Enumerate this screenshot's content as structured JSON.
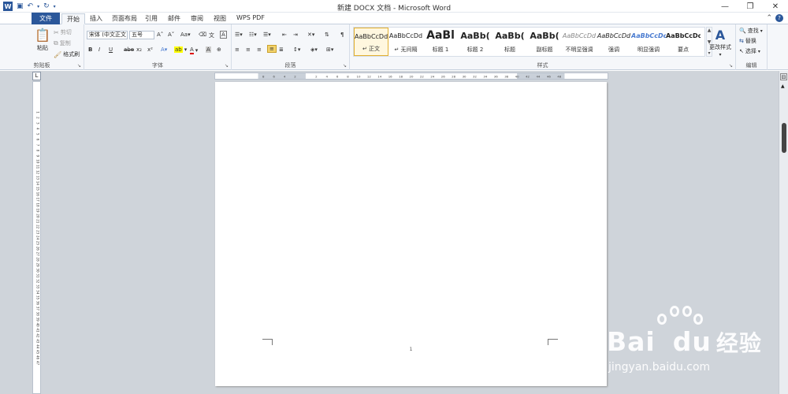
{
  "titlebar": {
    "title": "新建 DOCX 文档 - Microsoft Word",
    "app_icon": "W",
    "qat": [
      "save-icon",
      "undo-icon",
      "redo-icon",
      "customize-icon"
    ],
    "controls": [
      "—",
      "❐",
      "✕"
    ]
  },
  "tabs": {
    "file": "文件",
    "items": [
      "开始",
      "插入",
      "页面布局",
      "引用",
      "邮件",
      "审阅",
      "视图",
      "WPS PDF"
    ],
    "active": "开始"
  },
  "clipboard": {
    "paste": "粘贴",
    "cut": "剪切",
    "copy": "复制",
    "format_painter": "格式刷",
    "label": "剪贴板"
  },
  "font": {
    "name": "宋体 (中文正文",
    "size": "五号",
    "label": "字体",
    "buttons": [
      "B",
      "I",
      "U",
      "abe",
      "x₂",
      "x²"
    ]
  },
  "paragraph": {
    "label": "段落"
  },
  "styles": {
    "label": "样式",
    "items": [
      {
        "preview": "AaBbCcDd",
        "name": "↵ 正文",
        "selected": true
      },
      {
        "preview": "AaBbCcDd",
        "name": "↵ 无间隔"
      },
      {
        "preview": "AaBl",
        "name": "标题 1"
      },
      {
        "preview": "AaBb(",
        "name": "标题 2"
      },
      {
        "preview": "AaBb(",
        "name": "标题"
      },
      {
        "preview": "AaBb(",
        "name": "副标题"
      },
      {
        "preview": "AaBbCcDd",
        "name": "不明显强调"
      },
      {
        "preview": "AaBbCcDd",
        "name": "强调"
      },
      {
        "preview": "AaBbCcDc",
        "name": "明显强调"
      },
      {
        "preview": "AaBbCcDc",
        "name": "要点"
      }
    ],
    "change": "更改样式"
  },
  "editing": {
    "find": "查找",
    "replace": "替换",
    "select": "选择",
    "label": "编辑"
  },
  "ruler": {
    "h_ticks": [
      "8",
      "6",
      "4",
      "2",
      "",
      "2",
      "4",
      "6",
      "8",
      "10",
      "12",
      "14",
      "16",
      "18",
      "20",
      "22",
      "24",
      "26",
      "28",
      "30",
      "32",
      "34",
      "36",
      "38",
      "40",
      "42",
      "44",
      "46",
      "48"
    ],
    "v_ticks": [
      "1",
      "2",
      "3",
      "4",
      "5",
      "6",
      "7",
      "8",
      "9",
      "10",
      "11",
      "12",
      "13",
      "14",
      "15",
      "16",
      "17",
      "18",
      "19",
      "20",
      "21",
      "22",
      "23",
      "24",
      "25",
      "26",
      "27",
      "28",
      "29",
      "30",
      "31",
      "32",
      "33",
      "34",
      "35",
      "36",
      "37",
      "38",
      "39",
      "40",
      "41",
      "42",
      "43",
      "44",
      "45",
      "46",
      "47"
    ]
  },
  "document": {
    "page_number": "1"
  },
  "watermark": {
    "brand_a": "Bai",
    "brand_b": "du",
    "cn": "经验",
    "site": "jingyan.baidu.com"
  },
  "colors": {
    "accent": "#2b579a",
    "style_selected": "#e3b030",
    "background": "#cfd4da"
  }
}
